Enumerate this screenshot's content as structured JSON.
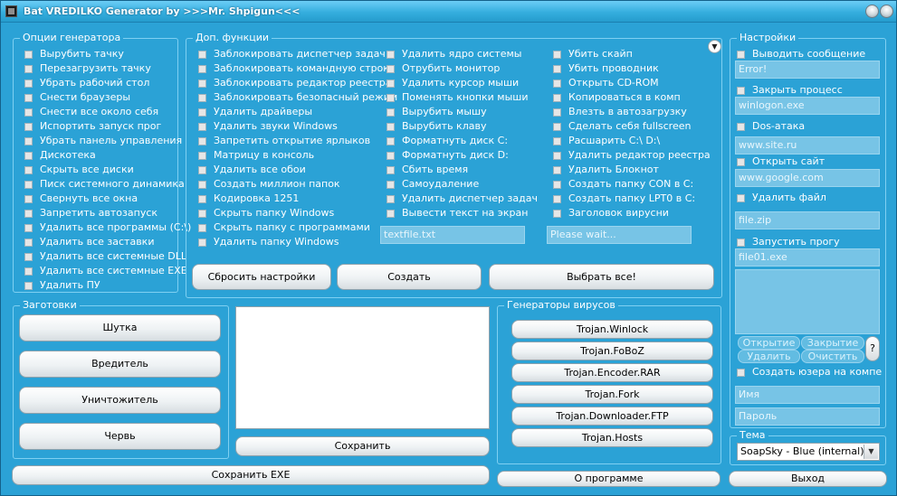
{
  "window": {
    "title": "Bat VREDILKO Generator by >>>Mr. Shpigun<<<"
  },
  "options": {
    "title": "Опции генератора",
    "items": [
      "Вырубить тачку",
      "Перезагрузить тачку",
      "Убрать рабочий стол",
      "Снести браузеры",
      "Снести все около себя",
      "Испортить запуск прог",
      "Убрать панель управления",
      "Дискотека",
      "Скрыть все диски",
      "Писк системного динамика",
      "Свернуть все окна",
      "Запретить автозапуск",
      "Удалить все программы (C:\\)",
      "Удалить все заставки",
      "Удалить все системные DLL",
      "Удалить все системные EXE",
      "Удалить ПУ"
    ]
  },
  "extra": {
    "title": "Доп. функции",
    "col1": [
      "Заблокировать диспетчер задач",
      "Заблокировать командную строку",
      "Заблокировать редактор реестра",
      "Заблокировать безопасный режим",
      "Удалить драйверы",
      "Удалить звуки Windows",
      "Запретить открытие ярлыков",
      "Матрицу в консоль",
      "Удалить все обои",
      "Создать миллион папок",
      "Кодировка 1251",
      "Скрыть папку Windows",
      "Скрыть папку с программами",
      "Удалить папку Windows"
    ],
    "col2": [
      "Удалить ядро системы",
      "Отрубить монитор",
      "Удалить курсор мыши",
      "Поменять кнопки мыши",
      "Вырубить мышу",
      "Вырубить клаву",
      "Форматнуть диск C:",
      "Форматнуть диск D:",
      "Сбить время",
      "Самоудаление",
      "Удалить диспетчер задач",
      "Вывести текст на экран"
    ],
    "col3": [
      "Убить скайп",
      "Убить проводник",
      "Открыть CD-ROM",
      "Копироваться в комп",
      "Влезть в автозагрузку",
      "Сделать себя fullscreen",
      "Расшарить C:\\ D:\\",
      "Удалить редактор реестра",
      "Удалить Блокнот",
      "Создать папку CON в C:",
      "Создать папку LPT0 в C:",
      "Заголовок вирусни"
    ],
    "text_field": "textfile.txt",
    "title_field": "Please wait...",
    "reset_label": "Сбросить настройки",
    "create_label": "Создать",
    "select_all_label": "Выбрать все!"
  },
  "presets": {
    "title": "Заготовки",
    "items": [
      "Шутка",
      "Вредитель",
      "Уничтожитель",
      "Червь"
    ]
  },
  "save_label": "Сохранить",
  "save_exe_label": "Сохранить EXE",
  "generators": {
    "title": "Генераторы вирусов",
    "items": [
      "Trojan.Winlock",
      "Trojan.FoBoZ",
      "Trojan.Encoder.RAR",
      "Trojan.Fork",
      "Trojan.Downloader.FTP",
      "Trojan.Hosts"
    ]
  },
  "about_label": "О программе",
  "exit_label": "Выход",
  "settings": {
    "title": "Настройки",
    "message": {
      "label": "Выводить сообщение",
      "value": "Error!"
    },
    "kill_process": {
      "label": "Закрыть процесс",
      "value": "winlogon.exe"
    },
    "dos": {
      "label": "Dos-атака",
      "value": "www.site.ru"
    },
    "open_site": {
      "label": "Открыть сайт",
      "value": "www.google.com"
    },
    "delete_file": {
      "label": "Удалить файл",
      "value": "file.zip"
    },
    "run_prog": {
      "label": "Запустить прогу",
      "value": "file01.exe"
    },
    "proc_buttons": {
      "open": "Открытие",
      "close": "Закрытие",
      "delete": "Удалить",
      "clear": "Очистить",
      "help": "?"
    },
    "create_user": {
      "label": "Создать юзера на компе",
      "name_placeholder": "Имя",
      "password_placeholder": "Пароль"
    }
  },
  "theme": {
    "title": "Тема",
    "value": "SoapSky - Blue (internal)"
  }
}
